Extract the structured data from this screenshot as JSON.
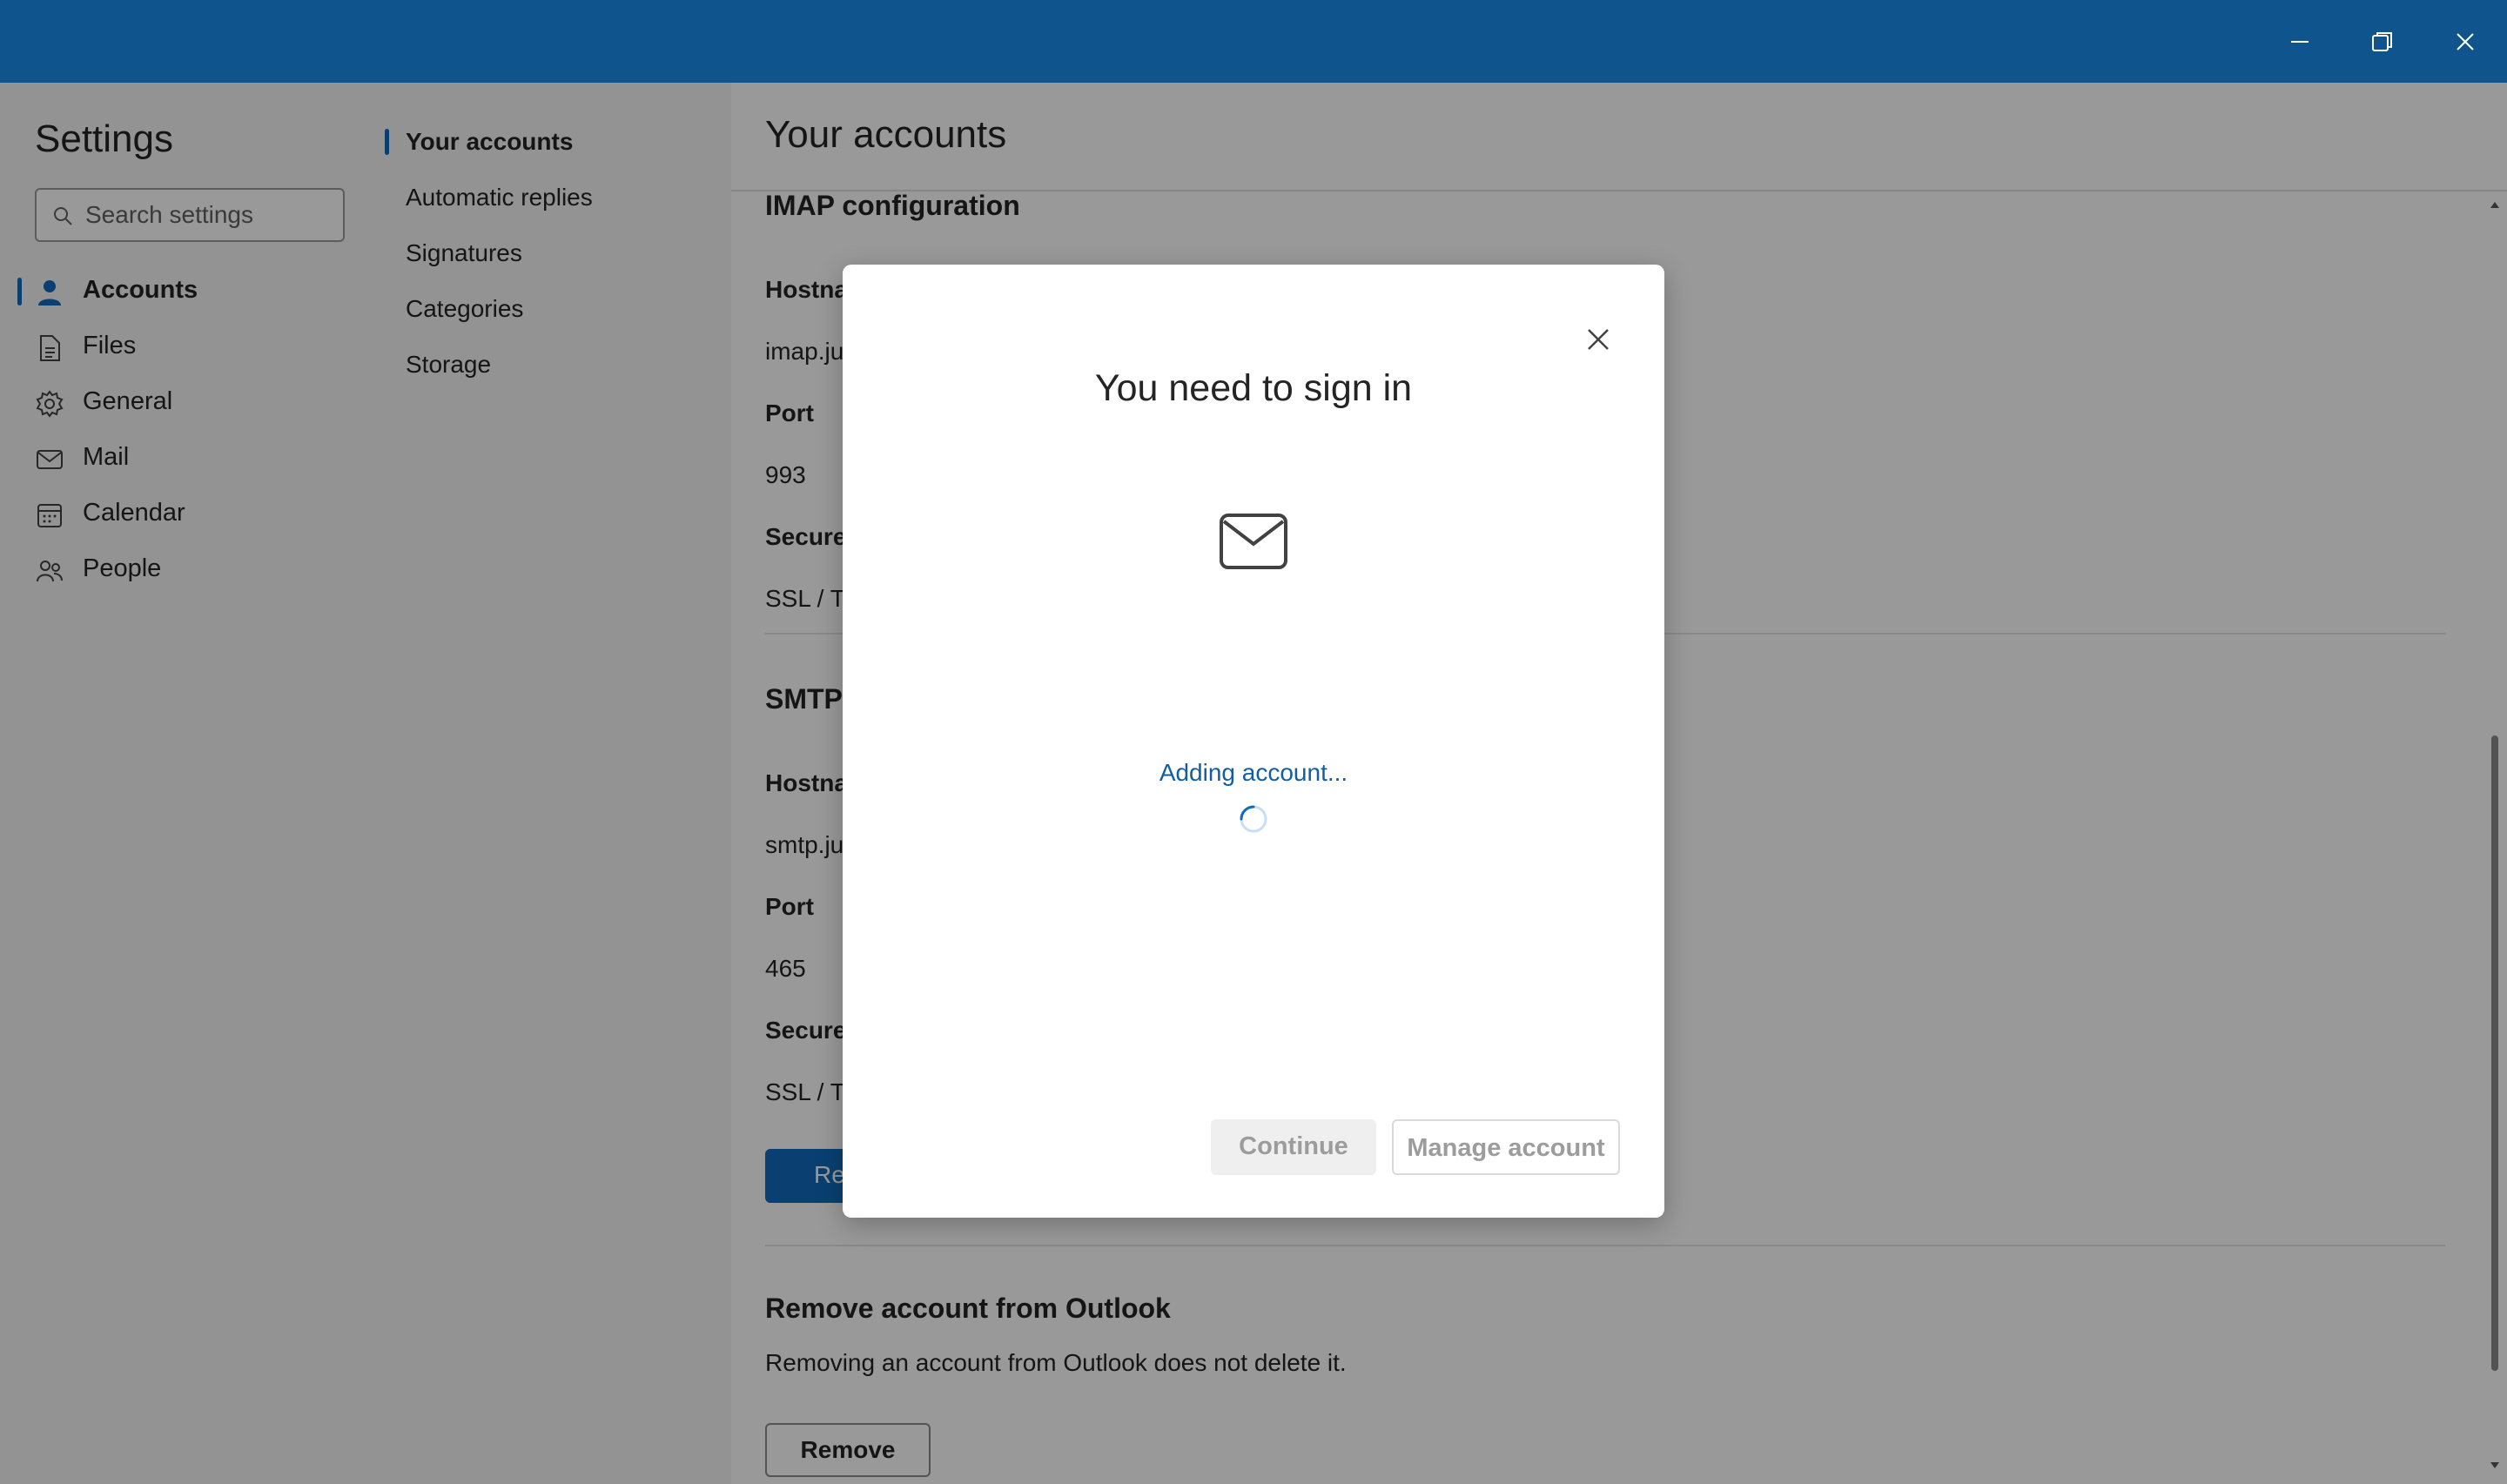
{
  "window": {
    "controls": {
      "minimize": "minimize-icon",
      "restore": "restore-icon",
      "close": "close-icon"
    },
    "titlebar_color": "#0f548c"
  },
  "sidebar": {
    "title": "Settings",
    "search_placeholder": "Search settings",
    "items": [
      {
        "label": "Accounts",
        "icon": "person-icon",
        "active": true
      },
      {
        "label": "Files",
        "icon": "file-icon",
        "active": false
      },
      {
        "label": "General",
        "icon": "gear-icon",
        "active": false
      },
      {
        "label": "Mail",
        "icon": "mail-icon",
        "active": false
      },
      {
        "label": "Calendar",
        "icon": "calendar-icon",
        "active": false
      },
      {
        "label": "People",
        "icon": "people-icon",
        "active": false
      }
    ]
  },
  "subnav": {
    "items": [
      {
        "label": "Your accounts",
        "active": true
      },
      {
        "label": "Automatic replies",
        "active": false
      },
      {
        "label": "Signatures",
        "active": false
      },
      {
        "label": "Categories",
        "active": false
      },
      {
        "label": "Storage",
        "active": false
      }
    ]
  },
  "main": {
    "title": "Your accounts",
    "imap": {
      "heading": "IMAP configuration",
      "hostname_label": "Hostna",
      "hostname_value": "imap.ju",
      "port_label": "Port",
      "port_value": "993",
      "secure_label": "Secure",
      "secure_value": "SSL / Tl"
    },
    "smtp": {
      "heading": "SMTP",
      "hostname_label": "Hostna",
      "hostname_value": "smtp.ju",
      "port_label": "Port",
      "port_value": "465",
      "secure_label": "Secure",
      "secure_value": "SSL / Tl"
    },
    "primary_button_label": "Re",
    "remove_section": {
      "heading": "Remove account from Outlook",
      "description": "Removing an account from Outlook does not delete it.",
      "button_label": "Remove"
    }
  },
  "dialog": {
    "title": "You need to sign in",
    "icon": "mail-icon",
    "status": "Adding account...",
    "continue_label": "Continue",
    "manage_label": "Manage account"
  },
  "colors": {
    "accent": "#0f6cbd",
    "status_text": "#115ea3"
  }
}
